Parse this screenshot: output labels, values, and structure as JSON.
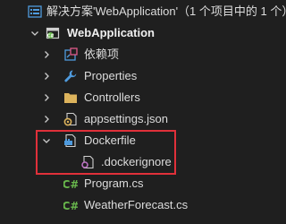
{
  "solution": {
    "label": "解决方案'WebApplication'（1 个项目中的 1 个）",
    "icon": "solution-icon"
  },
  "project": {
    "label": "WebApplication",
    "icon": "csharp-project-icon"
  },
  "items": {
    "dependencies": {
      "label": "依赖项",
      "icon": "dependencies-icon"
    },
    "properties": {
      "label": "Properties",
      "icon": "wrench-icon"
    },
    "controllers": {
      "label": "Controllers",
      "icon": "folder-icon"
    },
    "appsettings": {
      "label": "appsettings.json",
      "icon": "json-settings-icon"
    },
    "dockerfile": {
      "label": "Dockerfile",
      "icon": "docker-file-icon"
    },
    "dockerignore": {
      "label": ".dockerignore",
      "icon": "dockerignore-file-icon"
    },
    "program": {
      "label": "Program.cs",
      "icon": "csharp-file-icon"
    },
    "weather": {
      "label": "WeatherForecast.cs",
      "icon": "csharp-file-icon"
    }
  },
  "colors": {
    "background": "#1f1f1f",
    "highlight_border": "#e0303a",
    "csharp_green": "#68b74c",
    "folder_yellow": "#dcb35c",
    "icon_blue": "#4f9bde"
  }
}
